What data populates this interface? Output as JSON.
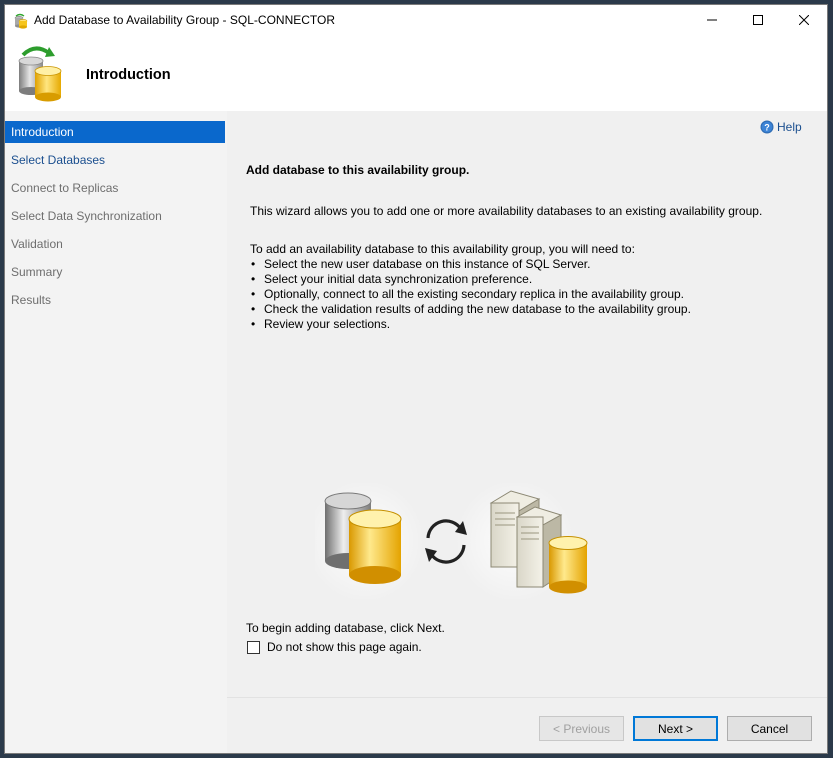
{
  "window": {
    "title": "Add Database to Availability Group - SQL-CONNECTOR"
  },
  "header": {
    "title": "Introduction"
  },
  "nav": {
    "items": [
      {
        "label": "Introduction",
        "state": "active"
      },
      {
        "label": "Select Databases",
        "state": "link"
      },
      {
        "label": "Connect to Replicas",
        "state": "disabled"
      },
      {
        "label": "Select Data Synchronization",
        "state": "disabled"
      },
      {
        "label": "Validation",
        "state": "disabled"
      },
      {
        "label": "Summary",
        "state": "disabled"
      },
      {
        "label": "Results",
        "state": "disabled"
      }
    ]
  },
  "content": {
    "help_label": "Help",
    "heading": "Add database to this availability group.",
    "paragraph": "This wizard allows you to add one or more availability databases to an existing availability group.",
    "list_intro": "To add an availability database to this availability group, you will need to:",
    "bullets": [
      "Select the new user database on this instance of SQL Server.",
      "Select your initial data synchronization preference.",
      "Optionally, connect to all the existing secondary replica in the availability group.",
      "Check the validation results of adding the new database to the availability group.",
      "Review your selections."
    ],
    "begin_text": "To begin adding database, click Next.",
    "checkbox_label": "Do not show this page again.",
    "checkbox_checked": false
  },
  "footer": {
    "previous_label": "< Previous",
    "next_label": "Next >",
    "cancel_label": "Cancel"
  },
  "colors": {
    "accent": "#0a68cc",
    "link": "#1b4f8f"
  }
}
